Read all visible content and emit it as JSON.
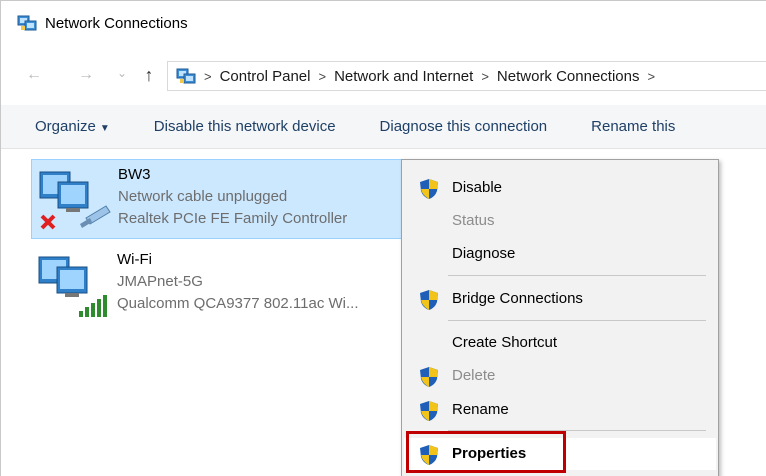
{
  "window": {
    "title": "Network Connections",
    "title_icon": "network-folder-icon"
  },
  "address": {
    "back": "←",
    "forward": "→",
    "recent": "⌄",
    "up": "↑",
    "crumbs": [
      "Control Panel",
      "Network and Internet",
      "Network Connections"
    ],
    "separator": ">"
  },
  "commands": {
    "organize": "Organize",
    "disable": "Disable this network device",
    "diagnose": "Diagnose this connection",
    "rename": "Rename this"
  },
  "connections": [
    {
      "name": "BW3",
      "status": "Network cable unplugged",
      "adapter": "Realtek PCIe FE Family Controller",
      "icon": "ethernet-disconnected-icon",
      "selected": true
    },
    {
      "name": "Wi-Fi",
      "status": "JMAPnet-5G",
      "adapter": "Qualcomm QCA9377 802.11ac Wi...",
      "icon": "wifi-connected-icon",
      "selected": false
    }
  ],
  "context_menu": {
    "items": [
      {
        "label": "Disable",
        "shield": true,
        "disabled": false
      },
      {
        "label": "Status",
        "shield": false,
        "disabled": true
      },
      {
        "label": "Diagnose",
        "shield": false,
        "disabled": false
      },
      {
        "label": "Bridge Connections",
        "shield": true,
        "disabled": false
      },
      {
        "label": "Create Shortcut",
        "shield": false,
        "disabled": false
      },
      {
        "label": "Delete",
        "shield": true,
        "disabled": true
      },
      {
        "label": "Rename",
        "shield": true,
        "disabled": false
      },
      {
        "label": "Properties",
        "shield": true,
        "disabled": false,
        "bold": true,
        "highlighted": true
      }
    ]
  },
  "colors": {
    "selection_bg": "#cce8ff",
    "selection_border": "#99d1ff",
    "command_text": "#1e3f66",
    "highlight_box": "#c00000"
  }
}
